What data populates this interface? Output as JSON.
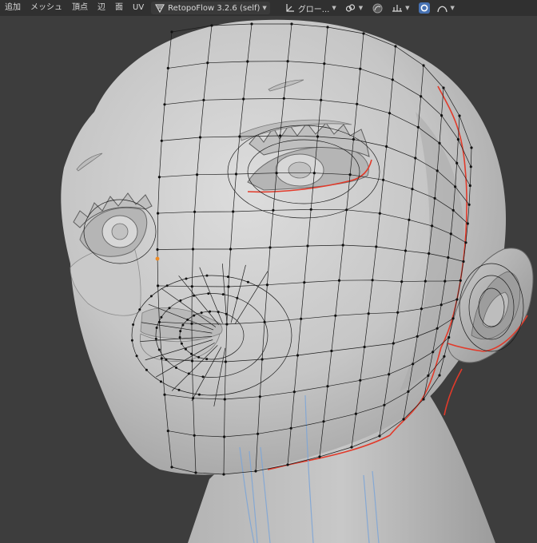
{
  "menu": {
    "add": "追加",
    "mesh": "メッシュ",
    "vertex": "頂点",
    "edge": "辺",
    "face": "面",
    "uv": "UV"
  },
  "tool": {
    "name": "RetopoFlow 3.2.6 (self)"
  },
  "transform": {
    "orientation": "グロー..."
  },
  "icons": {
    "tool": "retopoflow-icon",
    "orientation": "axes-icon",
    "pivot": "link-icon",
    "proportional": "proportional-icon",
    "snapping": "snap-icon",
    "xray": "xray-icon",
    "overlay": "curve-icon"
  },
  "colors": {
    "header_bg": "#303030",
    "viewport_bg": "#3d3d3d",
    "mesh_light": "#d6d6d6",
    "mesh_shadow": "#8a8a8a",
    "wire": "#1c1c1c",
    "seam": "#e23a2a",
    "guide_strokes": "#7fa6d6",
    "active_vertex": "#f08b22",
    "accent": "#4772b3"
  }
}
